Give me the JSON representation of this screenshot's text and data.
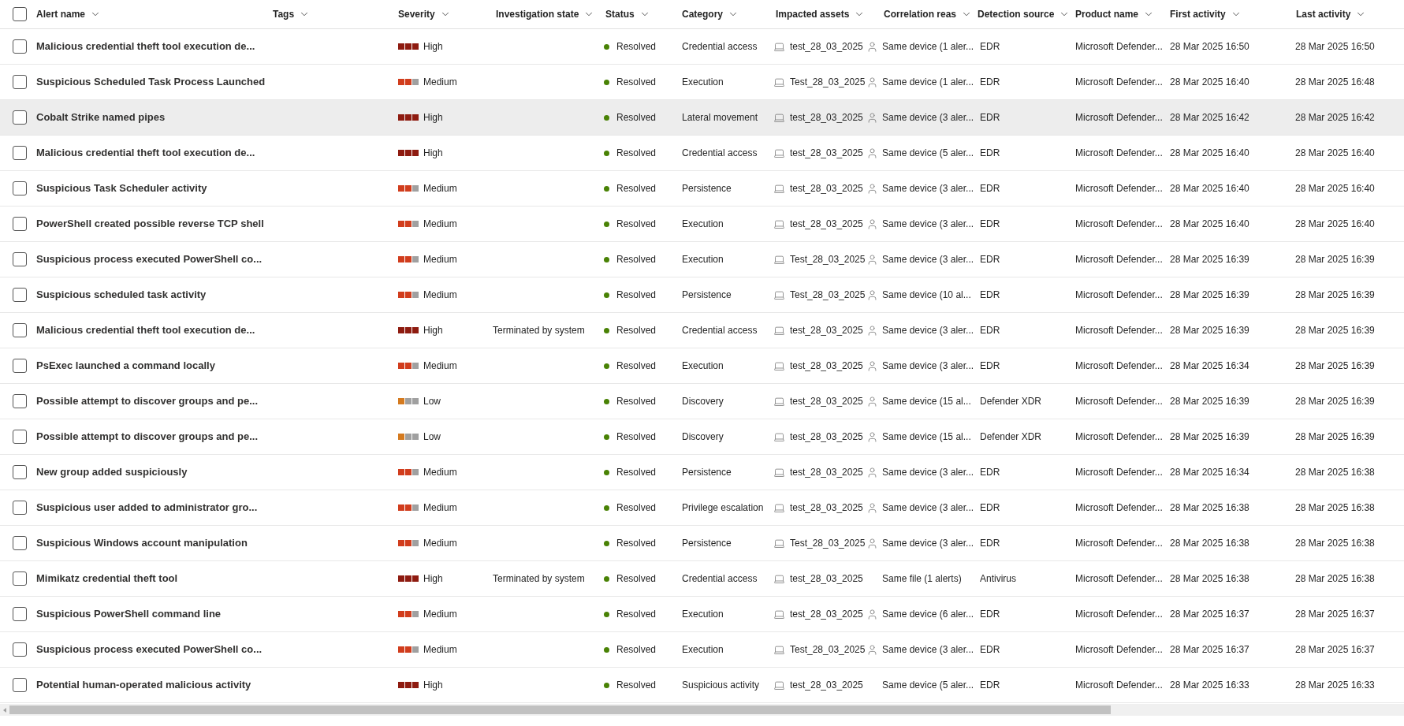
{
  "header": {
    "checked": false,
    "columns": [
      {
        "label": "Alert name"
      },
      {
        "label": "Tags"
      },
      {
        "label": "Severity"
      },
      {
        "label": "Investigation state"
      },
      {
        "label": "Status"
      },
      {
        "label": "Category"
      },
      {
        "label": "Impacted assets"
      },
      {
        "label": "Correlation reas"
      },
      {
        "label": "Detection source"
      },
      {
        "label": "Product name"
      },
      {
        "label": "First activity"
      },
      {
        "label": "Last activity"
      }
    ]
  },
  "rows": [
    {
      "checked": false,
      "highlighted": false,
      "name": "Malicious credential theft tool execution de...",
      "severity": {
        "kind": "high",
        "label": "High"
      },
      "investigation": "",
      "status": "Resolved",
      "category": "Credential access",
      "asset": "test_28_03_2025",
      "correlation": {
        "user_icon": true,
        "text": "Same device (1 aler..."
      },
      "source": "EDR",
      "product": "Microsoft Defender...",
      "first": "28 Mar 2025 16:50",
      "last": "28 Mar 2025 16:50"
    },
    {
      "checked": false,
      "highlighted": false,
      "name": "Suspicious Scheduled Task Process Launched",
      "severity": {
        "kind": "medium",
        "label": "Medium"
      },
      "investigation": "",
      "status": "Resolved",
      "category": "Execution",
      "asset": "Test_28_03_2025",
      "correlation": {
        "user_icon": true,
        "text": "Same device (1 aler..."
      },
      "source": "EDR",
      "product": "Microsoft Defender...",
      "first": "28 Mar 2025 16:40",
      "last": "28 Mar 2025 16:48"
    },
    {
      "checked": false,
      "highlighted": true,
      "name": "Cobalt Strike named pipes",
      "severity": {
        "kind": "high",
        "label": "High"
      },
      "investigation": "",
      "status": "Resolved",
      "category": "Lateral movement",
      "asset": "test_28_03_2025",
      "correlation": {
        "user_icon": true,
        "text": "Same device (3 aler..."
      },
      "source": "EDR",
      "product": "Microsoft Defender...",
      "first": "28 Mar 2025 16:42",
      "last": "28 Mar 2025 16:42"
    },
    {
      "checked": false,
      "highlighted": false,
      "name": "Malicious credential theft tool execution de...",
      "severity": {
        "kind": "high",
        "label": "High"
      },
      "investigation": "",
      "status": "Resolved",
      "category": "Credential access",
      "asset": "test_28_03_2025",
      "correlation": {
        "user_icon": true,
        "text": "Same device (5 aler..."
      },
      "source": "EDR",
      "product": "Microsoft Defender...",
      "first": "28 Mar 2025 16:40",
      "last": "28 Mar 2025 16:40"
    },
    {
      "checked": false,
      "highlighted": false,
      "name": "Suspicious Task Scheduler activity",
      "severity": {
        "kind": "medium",
        "label": "Medium"
      },
      "investigation": "",
      "status": "Resolved",
      "category": "Persistence",
      "asset": "test_28_03_2025",
      "correlation": {
        "user_icon": true,
        "text": "Same device (3 aler..."
      },
      "source": "EDR",
      "product": "Microsoft Defender...",
      "first": "28 Mar 2025 16:40",
      "last": "28 Mar 2025 16:40"
    },
    {
      "checked": false,
      "highlighted": false,
      "name": "PowerShell created possible reverse TCP shell",
      "severity": {
        "kind": "medium",
        "label": "Medium"
      },
      "investigation": "",
      "status": "Resolved",
      "category": "Execution",
      "asset": "test_28_03_2025",
      "correlation": {
        "user_icon": true,
        "text": "Same device (3 aler..."
      },
      "source": "EDR",
      "product": "Microsoft Defender...",
      "first": "28 Mar 2025 16:40",
      "last": "28 Mar 2025 16:40"
    },
    {
      "checked": false,
      "highlighted": false,
      "name": "Suspicious process executed PowerShell co...",
      "severity": {
        "kind": "medium",
        "label": "Medium"
      },
      "investigation": "",
      "status": "Resolved",
      "category": "Execution",
      "asset": "Test_28_03_2025",
      "correlation": {
        "user_icon": true,
        "text": "Same device (3 aler..."
      },
      "source": "EDR",
      "product": "Microsoft Defender...",
      "first": "28 Mar 2025 16:39",
      "last": "28 Mar 2025 16:39"
    },
    {
      "checked": false,
      "highlighted": false,
      "name": "Suspicious scheduled task activity",
      "severity": {
        "kind": "medium",
        "label": "Medium"
      },
      "investigation": "",
      "status": "Resolved",
      "category": "Persistence",
      "asset": "Test_28_03_2025",
      "correlation": {
        "user_icon": true,
        "text": "Same device (10 al..."
      },
      "source": "EDR",
      "product": "Microsoft Defender...",
      "first": "28 Mar 2025 16:39",
      "last": "28 Mar 2025 16:39"
    },
    {
      "checked": false,
      "highlighted": false,
      "name": "Malicious credential theft tool execution de...",
      "severity": {
        "kind": "high",
        "label": "High"
      },
      "investigation": "Terminated by system",
      "status": "Resolved",
      "category": "Credential access",
      "asset": "test_28_03_2025",
      "correlation": {
        "user_icon": true,
        "text": "Same device (3 aler..."
      },
      "source": "EDR",
      "product": "Microsoft Defender...",
      "first": "28 Mar 2025 16:39",
      "last": "28 Mar 2025 16:39"
    },
    {
      "checked": false,
      "highlighted": false,
      "name": "PsExec launched a command locally",
      "severity": {
        "kind": "medium",
        "label": "Medium"
      },
      "investigation": "",
      "status": "Resolved",
      "category": "Execution",
      "asset": "test_28_03_2025",
      "correlation": {
        "user_icon": true,
        "text": "Same device (3 aler..."
      },
      "source": "EDR",
      "product": "Microsoft Defender...",
      "first": "28 Mar 2025 16:34",
      "last": "28 Mar 2025 16:39"
    },
    {
      "checked": false,
      "highlighted": false,
      "name": "Possible attempt to discover groups and pe...",
      "severity": {
        "kind": "low",
        "label": "Low"
      },
      "investigation": "",
      "status": "Resolved",
      "category": "Discovery",
      "asset": "test_28_03_2025",
      "correlation": {
        "user_icon": true,
        "text": "Same device (15 al..."
      },
      "source": "Defender XDR",
      "product": "Microsoft Defender...",
      "first": "28 Mar 2025 16:39",
      "last": "28 Mar 2025 16:39"
    },
    {
      "checked": false,
      "highlighted": false,
      "name": "Possible attempt to discover groups and pe...",
      "severity": {
        "kind": "low",
        "label": "Low"
      },
      "investigation": "",
      "status": "Resolved",
      "category": "Discovery",
      "asset": "test_28_03_2025",
      "correlation": {
        "user_icon": true,
        "text": "Same device (15 al..."
      },
      "source": "Defender XDR",
      "product": "Microsoft Defender...",
      "first": "28 Mar 2025 16:39",
      "last": "28 Mar 2025 16:39"
    },
    {
      "checked": false,
      "highlighted": false,
      "name": "New group added suspiciously",
      "severity": {
        "kind": "medium",
        "label": "Medium"
      },
      "investigation": "",
      "status": "Resolved",
      "category": "Persistence",
      "asset": "test_28_03_2025",
      "correlation": {
        "user_icon": true,
        "text": "Same device (3 aler..."
      },
      "source": "EDR",
      "product": "Microsoft Defender...",
      "first": "28 Mar 2025 16:34",
      "last": "28 Mar 2025 16:38"
    },
    {
      "checked": false,
      "highlighted": false,
      "name": "Suspicious user added to administrator gro...",
      "severity": {
        "kind": "medium",
        "label": "Medium"
      },
      "investigation": "",
      "status": "Resolved",
      "category": "Privilege escalation",
      "asset": "test_28_03_2025",
      "correlation": {
        "user_icon": true,
        "text": "Same device (3 aler..."
      },
      "source": "EDR",
      "product": "Microsoft Defender...",
      "first": "28 Mar 2025 16:38",
      "last": "28 Mar 2025 16:38"
    },
    {
      "checked": false,
      "highlighted": false,
      "name": "Suspicious Windows account manipulation",
      "severity": {
        "kind": "medium",
        "label": "Medium"
      },
      "investigation": "",
      "status": "Resolved",
      "category": "Persistence",
      "asset": "Test_28_03_2025",
      "correlation": {
        "user_icon": true,
        "text": "Same device (3 aler..."
      },
      "source": "EDR",
      "product": "Microsoft Defender...",
      "first": "28 Mar 2025 16:38",
      "last": "28 Mar 2025 16:38"
    },
    {
      "checked": false,
      "highlighted": false,
      "name": "Mimikatz credential theft tool",
      "severity": {
        "kind": "high",
        "label": "High"
      },
      "investigation": "Terminated by system",
      "status": "Resolved",
      "category": "Credential access",
      "asset": "test_28_03_2025",
      "correlation": {
        "user_icon": false,
        "text": "Same file (1 alerts)"
      },
      "source": "Antivirus",
      "product": "Microsoft Defender...",
      "first": "28 Mar 2025 16:38",
      "last": "28 Mar 2025 16:38"
    },
    {
      "checked": false,
      "highlighted": false,
      "name": "Suspicious PowerShell command line",
      "severity": {
        "kind": "medium",
        "label": "Medium"
      },
      "investigation": "",
      "status": "Resolved",
      "category": "Execution",
      "asset": "test_28_03_2025",
      "correlation": {
        "user_icon": true,
        "text": "Same device (6 aler..."
      },
      "source": "EDR",
      "product": "Microsoft Defender...",
      "first": "28 Mar 2025 16:37",
      "last": "28 Mar 2025 16:37"
    },
    {
      "checked": false,
      "highlighted": false,
      "name": "Suspicious process executed PowerShell co...",
      "severity": {
        "kind": "medium",
        "label": "Medium"
      },
      "investigation": "",
      "status": "Resolved",
      "category": "Execution",
      "asset": "Test_28_03_2025",
      "correlation": {
        "user_icon": true,
        "text": "Same device (3 aler..."
      },
      "source": "EDR",
      "product": "Microsoft Defender...",
      "first": "28 Mar 2025 16:37",
      "last": "28 Mar 2025 16:37"
    },
    {
      "checked": false,
      "highlighted": false,
      "name": "Potential human-operated malicious activity",
      "severity": {
        "kind": "high",
        "label": "High"
      },
      "investigation": "",
      "status": "Resolved",
      "category": "Suspicious activity",
      "asset": "test_28_03_2025",
      "correlation": {
        "user_icon": false,
        "text": "Same device (5 aler..."
      },
      "source": "EDR",
      "product": "Microsoft Defender...",
      "first": "28 Mar 2025 16:33",
      "last": "28 Mar 2025 16:33"
    }
  ]
}
